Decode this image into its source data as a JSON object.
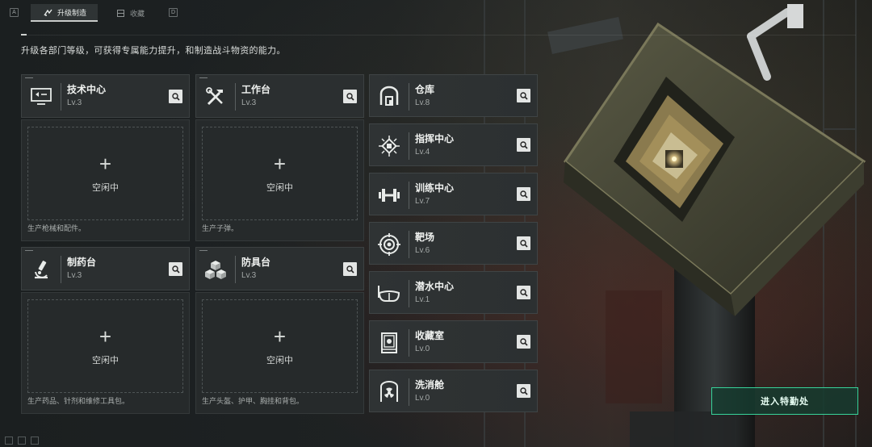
{
  "topbar": {
    "left_key": "A",
    "right_key": "D",
    "tabs": [
      {
        "label": "升级制造",
        "icon": "upgrade-icon",
        "active": true
      },
      {
        "label": "收藏",
        "icon": "collection-icon",
        "active": false
      }
    ]
  },
  "subtitle": "升级各部门等级，可获得专属能力提升，和制造战斗物资的能力。",
  "production_facilities": [
    {
      "name": "技术中心",
      "level": "Lv.3",
      "icon": "monitor-icon",
      "slot_status": "空闲中",
      "plus": "+",
      "description": "生产枪械和配件。"
    },
    {
      "name": "工作台",
      "level": "Lv.3",
      "icon": "tools-icon",
      "slot_status": "空闲中",
      "plus": "+",
      "description": "生产子弹。"
    },
    {
      "name": "制药台",
      "level": "Lv.3",
      "icon": "microscope-icon",
      "slot_status": "空闲中",
      "plus": "+",
      "description": "生产药品、针剂和维修工具包。"
    },
    {
      "name": "防具台",
      "level": "Lv.3",
      "icon": "cubes-icon",
      "slot_status": "空闲中",
      "plus": "+",
      "description": "生产头盔、护甲、胸挂和背包。"
    }
  ],
  "other_facilities": [
    {
      "name": "仓库",
      "level": "Lv.8",
      "icon": "warehouse-icon"
    },
    {
      "name": "指挥中心",
      "level": "Lv.4",
      "icon": "chip-icon"
    },
    {
      "name": "训练中心",
      "level": "Lv.7",
      "icon": "dumbbell-icon"
    },
    {
      "name": "靶场",
      "level": "Lv.6",
      "icon": "target-icon"
    },
    {
      "name": "潜水中心",
      "level": "Lv.1",
      "icon": "diving-mask-icon"
    },
    {
      "name": "收藏室",
      "level": "Lv.0",
      "icon": "display-case-icon"
    },
    {
      "name": "洗消舱",
      "level": "Lv.0",
      "icon": "radiation-chamber-icon"
    }
  ],
  "enter_button": "进入特勤处",
  "colors": {
    "accent": "#37d39a",
    "card_bg": "#2b2f30",
    "panel_bg": "#262a2b"
  }
}
